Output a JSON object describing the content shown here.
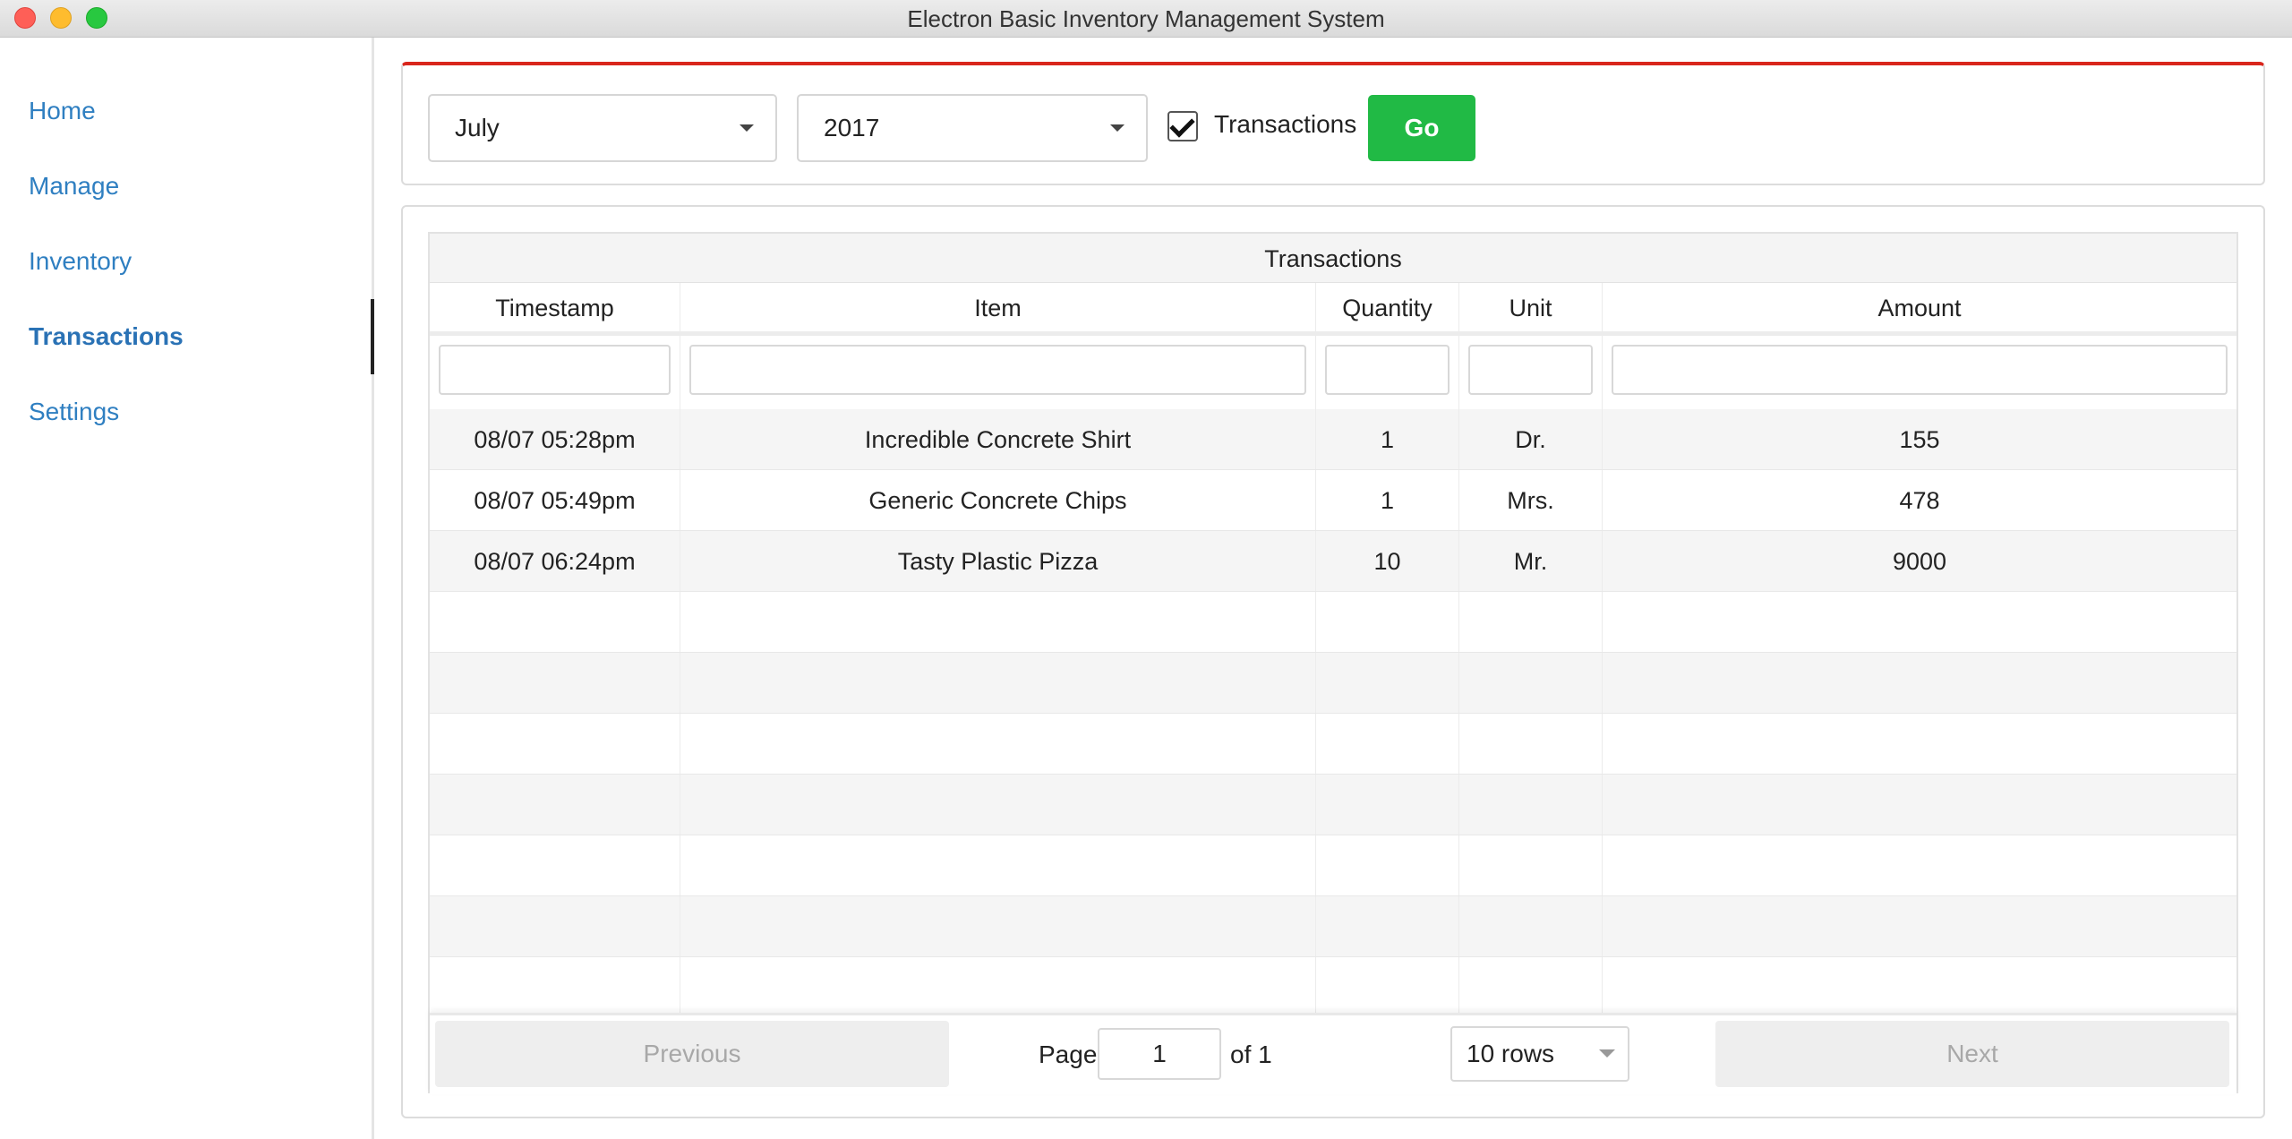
{
  "window": {
    "title": "Electron Basic Inventory Management System"
  },
  "sidebar": {
    "items": [
      {
        "label": "Home"
      },
      {
        "label": "Manage"
      },
      {
        "label": "Inventory"
      },
      {
        "label": "Transactions",
        "active": true
      },
      {
        "label": "Settings"
      }
    ]
  },
  "filters": {
    "month": "July",
    "year": "2017",
    "transactions_checked": true,
    "transactions_label": "Transactions",
    "go_label": "Go"
  },
  "table": {
    "caption": "Transactions",
    "columns": [
      "Timestamp",
      "Item",
      "Quantity",
      "Unit",
      "Amount"
    ],
    "rows": [
      [
        "08/07 05:28pm",
        "Incredible Concrete Shirt",
        "1",
        "Dr.",
        "155"
      ],
      [
        "08/07 05:49pm",
        "Generic Concrete Chips",
        "1",
        "Mrs.",
        "478"
      ],
      [
        "08/07 06:24pm",
        "Tasty Plastic Pizza",
        "10",
        "Mr.",
        "9000"
      ]
    ]
  },
  "pagination": {
    "previous_label": "Previous",
    "next_label": "Next",
    "page_label": "Page",
    "page_value": "1",
    "of_label": "of 1",
    "rows_option": "10 rows"
  },
  "colors": {
    "accent_red": "#d9261c",
    "go_green": "#21ba45",
    "link_blue": "#2f7fc1"
  }
}
